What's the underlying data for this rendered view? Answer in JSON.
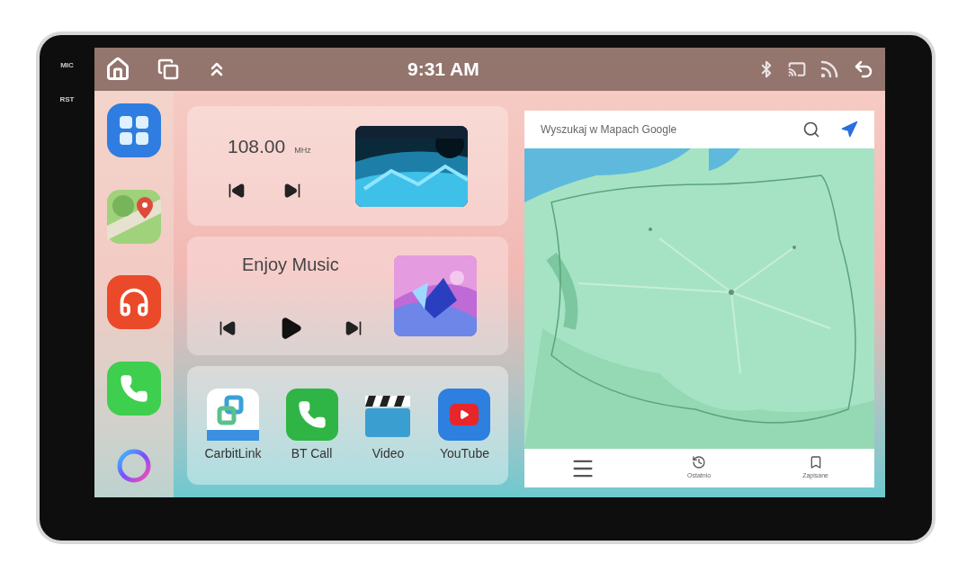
{
  "device": {
    "bezel_labels": [
      "MIC",
      "RST"
    ]
  },
  "status_bar": {
    "time": "9:31 AM",
    "left_icons": [
      {
        "kind": "home"
      },
      {
        "kind": "windows"
      },
      {
        "kind": "up"
      }
    ],
    "right_icons": [
      {
        "kind": "bluetooth"
      },
      {
        "kind": "cast"
      },
      {
        "kind": "signal"
      },
      {
        "kind": "back"
      }
    ]
  },
  "dock": [
    {
      "kind": "apps"
    },
    {
      "kind": "maps"
    },
    {
      "kind": "music"
    },
    {
      "kind": "phone"
    },
    {
      "kind": "assistant"
    }
  ],
  "radio": {
    "frequency": "108.00",
    "unit": "MHz"
  },
  "music": {
    "title": "Enjoy Music"
  },
  "apps": [
    {
      "label": "CarbitLink",
      "kind": "link"
    },
    {
      "label": "BT Call",
      "kind": "phone"
    },
    {
      "label": "Video",
      "kind": "clapper"
    },
    {
      "label": "YouTube",
      "kind": "play"
    }
  ],
  "map": {
    "search": {
      "placeholder": "Wyszukaj w Mapach Google"
    },
    "nav": [
      {
        "kind": "menu"
      },
      {
        "kind": "recent",
        "label": "Ostatnio"
      },
      {
        "kind": "saved",
        "label": "Zapisane"
      }
    ]
  }
}
